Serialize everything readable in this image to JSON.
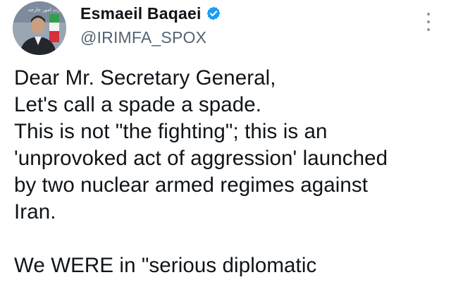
{
  "author": {
    "display_name": "Esmaeil Baqaei",
    "handle": "@IRIMFA_SPOX",
    "verified_color": "#1d9bf0",
    "avatar_caption": "وزارت امور خارجه"
  },
  "icons": {
    "verified": "verified-badge-icon",
    "more": "more-vertical-icon"
  },
  "tweet": {
    "lines": [
      "Dear Mr. Secretary General,",
      "Let's call a spade a spade.",
      "This is not \"the fighting\"; this is an",
      "'unprovoked act of aggression' launched",
      "by two nuclear armed regimes against",
      "Iran.",
      "",
      "We WERE in \"serious diplomatic"
    ]
  }
}
